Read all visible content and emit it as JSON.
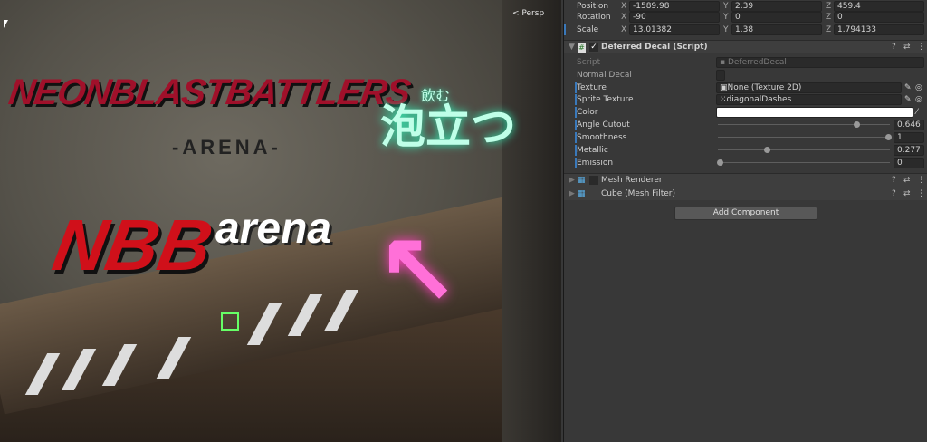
{
  "scene": {
    "view_mode": "Persp",
    "logo_top": "NEONBLASTBATTLERS",
    "logo_sub": "-ARENA-",
    "logo_main": "NBB",
    "logo_arena": "arena",
    "neon_text": "泡立つ",
    "neon_small": "飲む"
  },
  "transform": {
    "position": {
      "label": "Position",
      "x": "-1589.98",
      "y": "2.39",
      "z": "459.4"
    },
    "rotation": {
      "label": "Rotation",
      "x": "-90",
      "y": "0",
      "z": "0"
    },
    "scale": {
      "label": "Scale",
      "x": "13.01382",
      "y": "1.38",
      "z": "1.794133"
    },
    "axes": {
      "x": "X",
      "y": "Y",
      "z": "Z"
    }
  },
  "decal": {
    "title": "Deferred Decal (Script)",
    "enabled": true,
    "script_label": "Script",
    "script_value": "DeferredDecal",
    "normal_label": "Normal Decal",
    "normal_value": false,
    "texture_label": "Texture",
    "texture_value": "None (Texture 2D)",
    "sprite_label": "Sprite Texture",
    "sprite_value": "diagonalDashes",
    "color_label": "Color",
    "color_value": "#ffffff",
    "sliders": [
      {
        "label": "Angle Cutout",
        "value": "0.646",
        "fraction": 0.81
      },
      {
        "label": "Smoothness",
        "value": "1",
        "fraction": 1
      },
      {
        "label": "Metallic",
        "value": "0.277",
        "fraction": 0.28
      },
      {
        "label": "Emission",
        "value": "0",
        "fraction": 0
      }
    ]
  },
  "components": [
    {
      "title": "Mesh Renderer"
    },
    {
      "title": "Cube (Mesh Filter)"
    }
  ],
  "add_component": "Add Component"
}
